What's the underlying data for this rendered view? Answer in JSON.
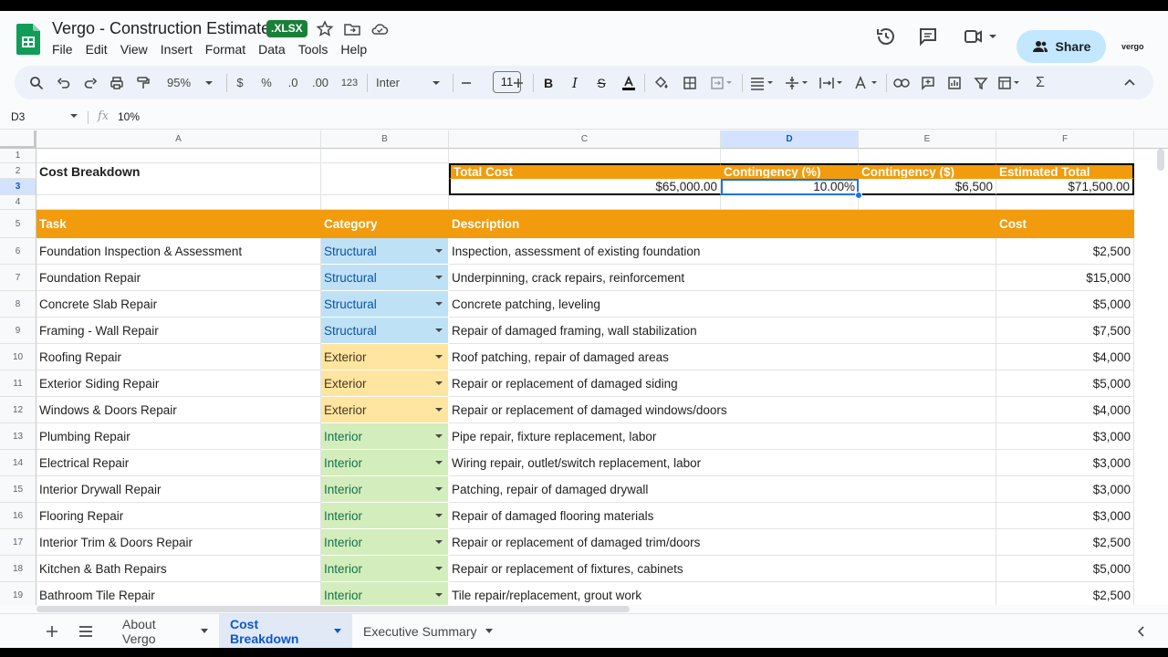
{
  "app": {
    "doc_title": "Vergo - Construction Estimate",
    "file_badge": ".XLSX",
    "menu": [
      "File",
      "Edit",
      "View",
      "Insert",
      "Format",
      "Data",
      "Tools",
      "Help"
    ],
    "share_label": "Share",
    "brand_mini": "vergo"
  },
  "toolbar": {
    "zoom": "95%",
    "currency": "$",
    "percent": "%",
    "dec_decrease": ".0",
    "dec_increase": ".00",
    "number_format": "123",
    "font": "Inter",
    "font_size": "11"
  },
  "formula_bar": {
    "cell_ref": "D3",
    "fx": "fx",
    "value": "10%"
  },
  "columns": [
    "A",
    "B",
    "C",
    "D",
    "E",
    "F"
  ],
  "selected_column": "D",
  "rows": [
    "1",
    "2",
    "3",
    "4",
    "5",
    "6",
    "7",
    "8",
    "9",
    "10",
    "11",
    "12",
    "13",
    "14",
    "15",
    "16",
    "17",
    "18",
    "19"
  ],
  "sheet": {
    "title": "Cost Breakdown",
    "summary_headers": [
      "Total Cost",
      "Contingency (%)",
      "Contingency ($)",
      "Estimated Total"
    ],
    "summary_values": [
      "$65,000.00",
      "10.00%",
      "$6,500",
      "$71,500.00"
    ],
    "table_headers": [
      "Task",
      "Category",
      "Description",
      "Cost"
    ],
    "table_rows": [
      {
        "task": "Foundation Inspection & Assessment",
        "category": "Structural",
        "description": "Inspection, assessment of existing foundation",
        "cost": "$2,500"
      },
      {
        "task": "Foundation Repair",
        "category": "Structural",
        "description": "Underpinning, crack repairs, reinforcement",
        "cost": "$15,000"
      },
      {
        "task": "Concrete Slab Repair",
        "category": "Structural",
        "description": "Concrete patching, leveling",
        "cost": "$5,000"
      },
      {
        "task": "Framing - Wall Repair",
        "category": "Structural",
        "description": "Repair of damaged framing, wall stabilization",
        "cost": "$7,500"
      },
      {
        "task": "Roofing Repair",
        "category": "Exterior",
        "description": "Roof patching, repair of damaged areas",
        "cost": "$4,000"
      },
      {
        "task": "Exterior Siding Repair",
        "category": "Exterior",
        "description": "Repair or replacement of damaged siding",
        "cost": "$5,000"
      },
      {
        "task": "Windows & Doors Repair",
        "category": "Exterior",
        "description": "Repair or replacement of damaged windows/doors",
        "cost": "$4,000"
      },
      {
        "task": "Plumbing Repair",
        "category": "Interior",
        "description": "Pipe repair, fixture replacement, labor",
        "cost": "$3,000"
      },
      {
        "task": "Electrical Repair",
        "category": "Interior",
        "description": "Wiring repair, outlet/switch replacement, labor",
        "cost": "$3,000"
      },
      {
        "task": "Interior Drywall Repair",
        "category": "Interior",
        "description": "Patching, repair of damaged drywall",
        "cost": "$3,000"
      },
      {
        "task": "Flooring Repair",
        "category": "Interior",
        "description": "Repair of damaged flooring materials",
        "cost": "$3,000"
      },
      {
        "task": "Interior Trim & Doors Repair",
        "category": "Interior",
        "description": "Repair or replacement of damaged trim/doors",
        "cost": "$2,500"
      },
      {
        "task": "Kitchen & Bath Repairs",
        "category": "Interior",
        "description": "Repair or replacement of fixtures, cabinets",
        "cost": "$5,000"
      },
      {
        "task": "Bathroom Tile Repair",
        "category": "Interior",
        "description": "Tile repair/replacement, grout work",
        "cost": "$2,500"
      }
    ]
  },
  "category_colors": {
    "Structural": {
      "bg": "#bfe1f6",
      "fg": "#0a53a8"
    },
    "Exterior": {
      "bg": "#ffe5a0",
      "fg": "#473821"
    },
    "Interior": {
      "bg": "#d4edbc",
      "fg": "#11734b"
    }
  },
  "colors": {
    "header_orange": "#f29b0c",
    "selection_blue": "#d3e3fd",
    "share_bg": "#c2e7ff",
    "badge_green": "#188038"
  },
  "tabs": [
    {
      "label": "About Vergo",
      "active": false
    },
    {
      "label": "Cost Breakdown",
      "active": true
    },
    {
      "label": "Executive Summary",
      "active": false
    }
  ]
}
